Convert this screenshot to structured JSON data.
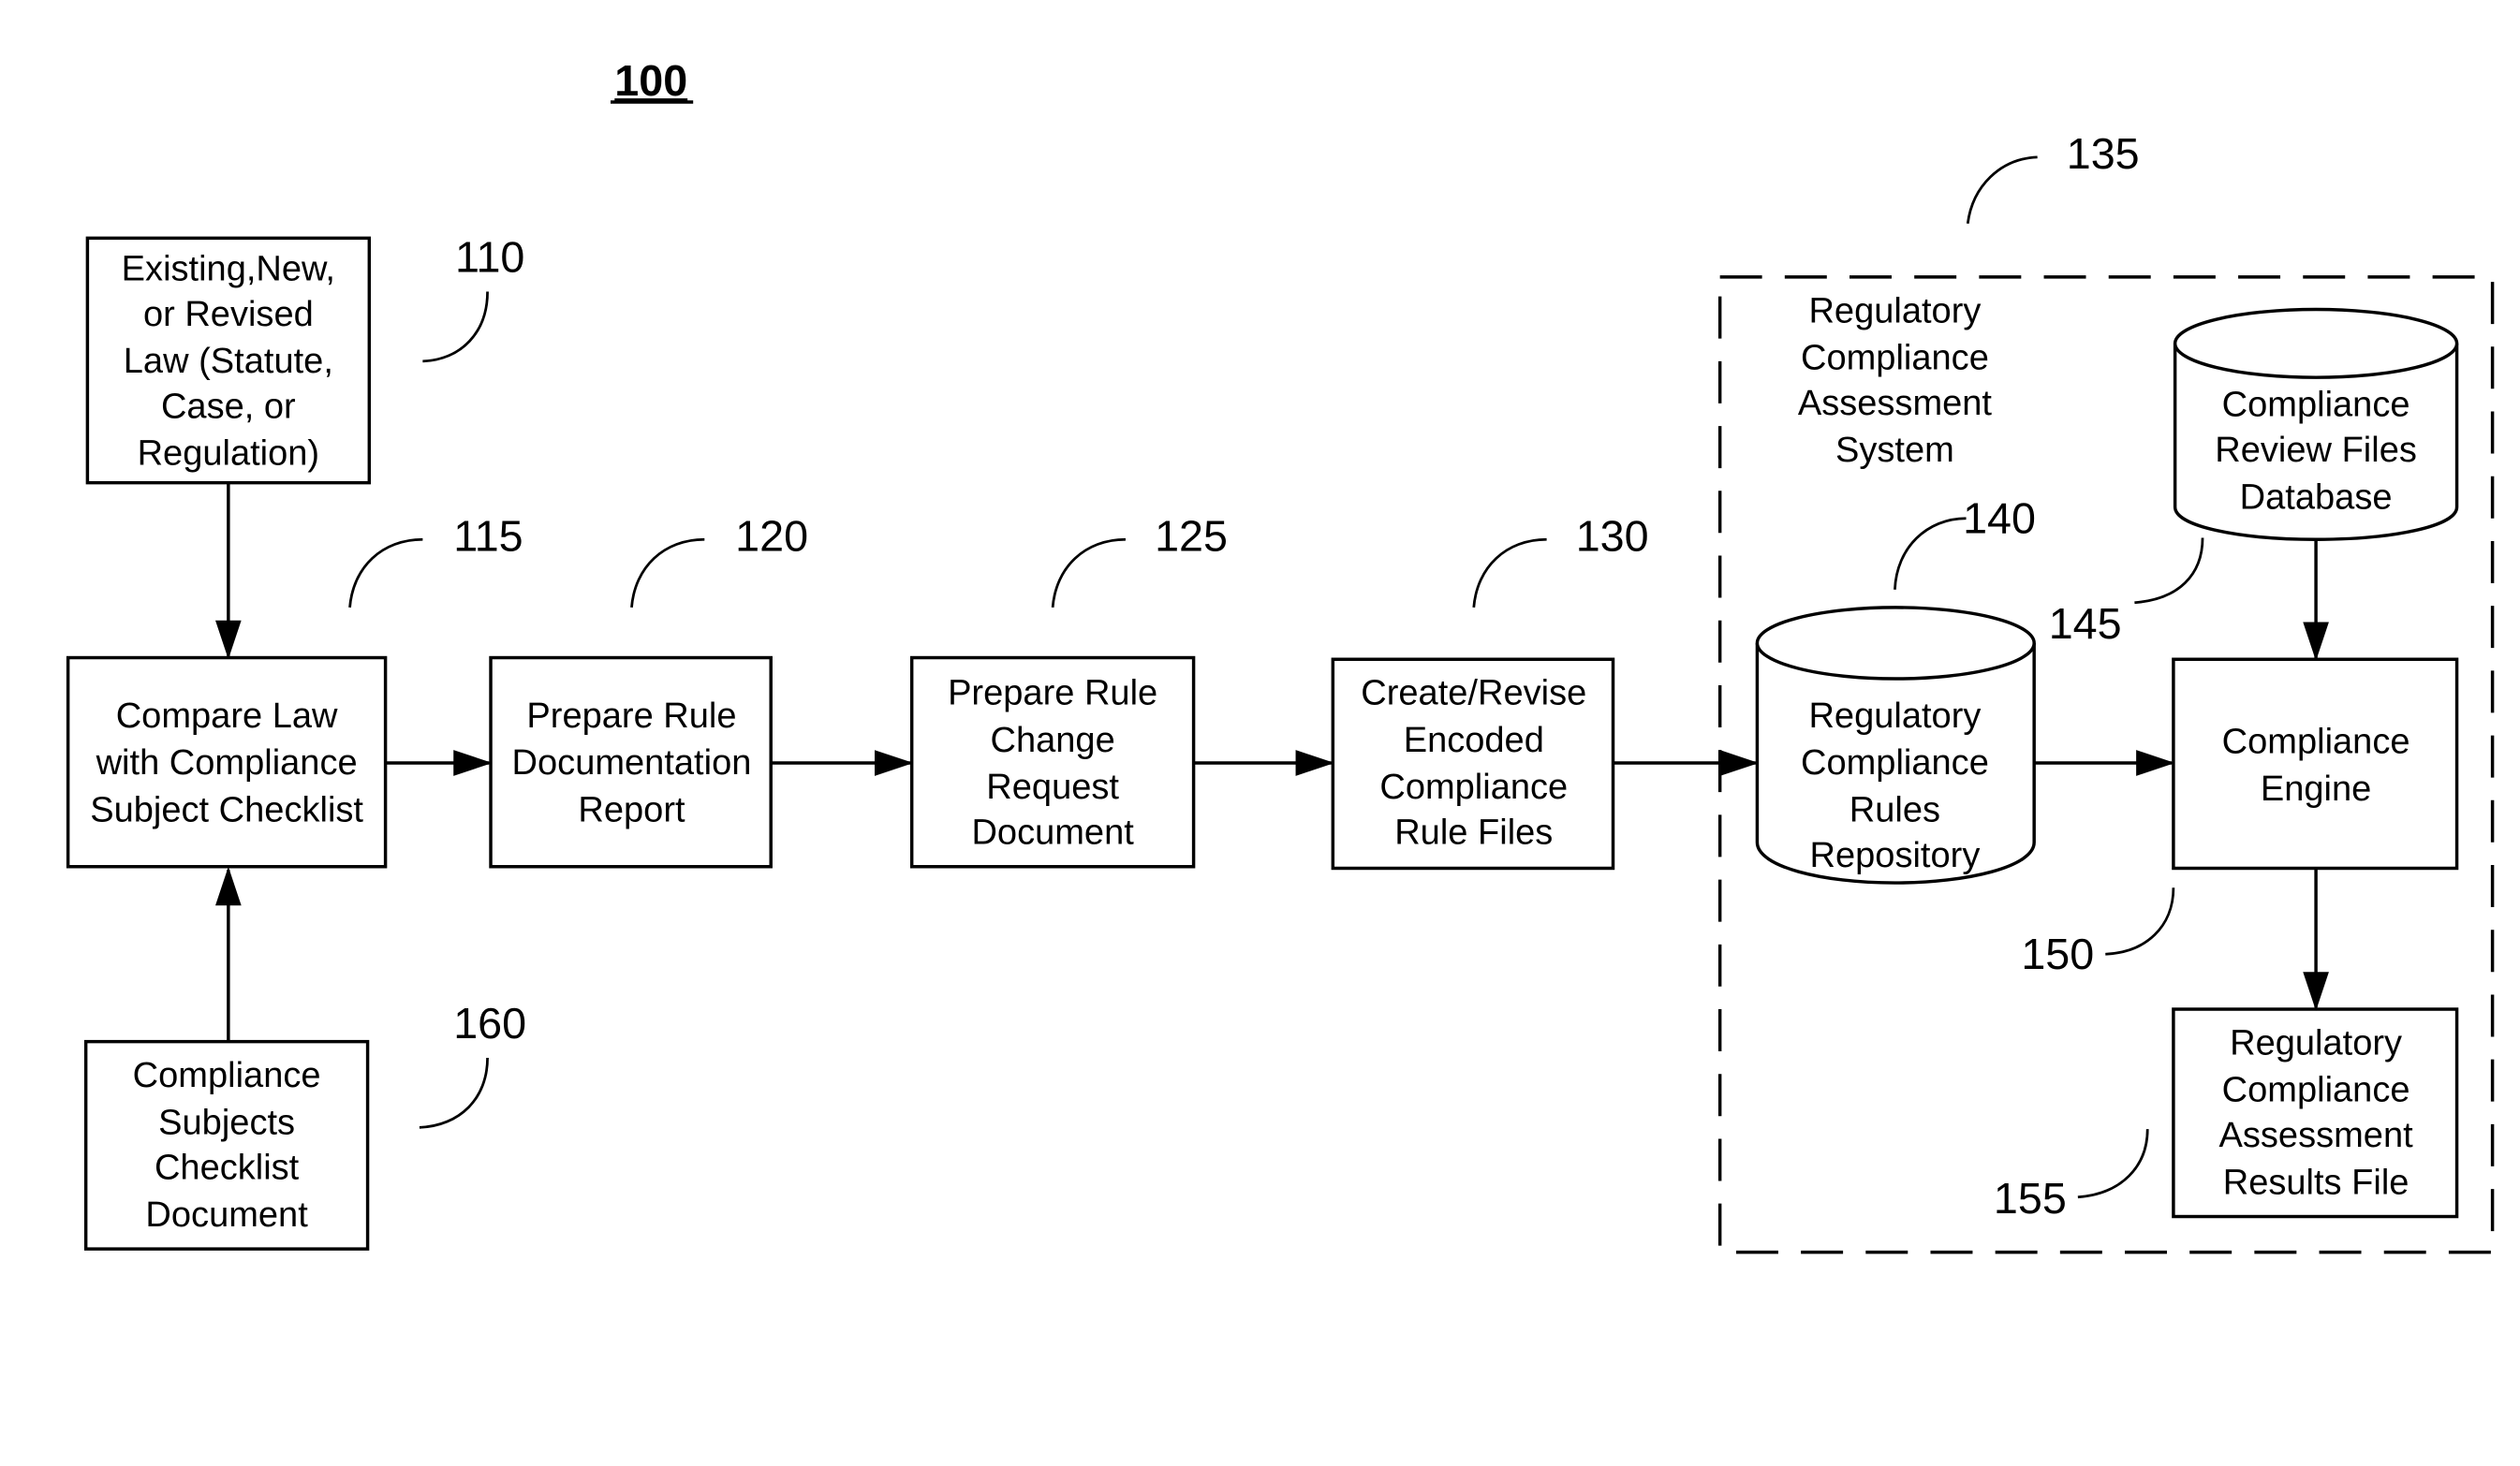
{
  "figure": {
    "number": "100",
    "group": {
      "ref": "135",
      "title_lines": [
        "Regulatory",
        "Compliance",
        "Assessment",
        "System"
      ]
    },
    "nodes": [
      {
        "id": "n110",
        "ref": "110",
        "shape": "rect",
        "lines": [
          "Existing,New,",
          "or Revised",
          "Law (Statute,",
          "Case, or",
          "Regulation)"
        ]
      },
      {
        "id": "n115",
        "ref": "115",
        "shape": "rect",
        "lines": [
          "Compare Law",
          "with Compliance",
          "Subject Checklist"
        ]
      },
      {
        "id": "n120",
        "ref": "120",
        "shape": "rect",
        "lines": [
          "Prepare Rule",
          "Documentation",
          "Report"
        ]
      },
      {
        "id": "n125",
        "ref": "125",
        "shape": "rect",
        "lines": [
          "Prepare Rule",
          "Change",
          "Request",
          "Document"
        ]
      },
      {
        "id": "n130",
        "ref": "130",
        "shape": "rect",
        "lines": [
          "Create/Revise",
          "Encoded",
          "Compliance",
          "Rule Files"
        ]
      },
      {
        "id": "n140",
        "ref": "140",
        "shape": "cylinder",
        "lines": [
          "Regulatory",
          "Compliance",
          "Rules",
          "Repository"
        ]
      },
      {
        "id": "n145",
        "ref": "145",
        "shape": "cylinder",
        "lines": [
          "Compliance",
          "Review Files",
          "Database"
        ]
      },
      {
        "id": "n150",
        "ref": "150",
        "shape": "rect",
        "lines": [
          "Compliance",
          "Engine"
        ]
      },
      {
        "id": "n155",
        "ref": "155",
        "shape": "rect",
        "lines": [
          "Regulatory",
          "Compliance",
          "Assessment",
          "Results File"
        ]
      },
      {
        "id": "n160",
        "ref": "160",
        "shape": "rect",
        "lines": [
          "Compliance",
          "Subjects",
          "Checklist",
          "Document"
        ]
      }
    ],
    "edges": [
      {
        "from": "110",
        "to": "115"
      },
      {
        "from": "160",
        "to": "115"
      },
      {
        "from": "115",
        "to": "120"
      },
      {
        "from": "120",
        "to": "125"
      },
      {
        "from": "125",
        "to": "130"
      },
      {
        "from": "130",
        "to": "140"
      },
      {
        "from": "140",
        "to": "150"
      },
      {
        "from": "145",
        "to": "150"
      },
      {
        "from": "150",
        "to": "155"
      }
    ]
  }
}
